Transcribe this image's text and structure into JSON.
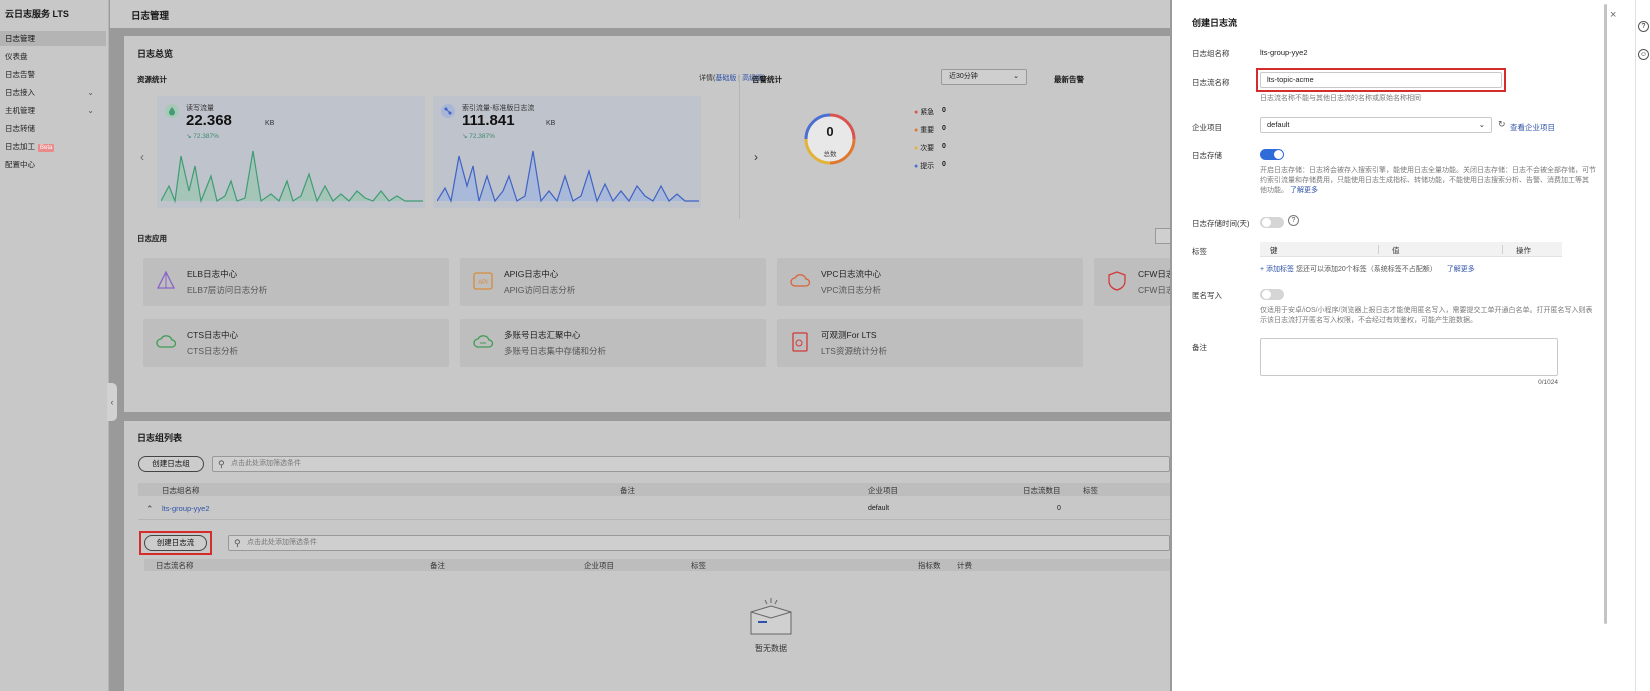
{
  "sidebar": {
    "title": "云日志服务 LTS",
    "items": [
      {
        "label": "日志管理",
        "active": true
      },
      {
        "label": "仪表盘"
      },
      {
        "label": "日志告警"
      },
      {
        "label": "日志接入",
        "chevron": "chevron-down-icon"
      },
      {
        "label": "主机管理",
        "chevron": "chevron-down-icon"
      },
      {
        "label": "日志转储"
      },
      {
        "label": "日志加工",
        "badge": "Beta"
      },
      {
        "label": "配置中心"
      }
    ]
  },
  "page": {
    "title": "日志管理"
  },
  "overview": {
    "title": "日志总览",
    "resource_title": "资源统计",
    "detail_prefix": "详情(",
    "detail_basic": "基础版",
    "detail_sep": " | ",
    "detail_advanced": "高级版",
    "detail_suffix": ")",
    "read_write": {
      "label": "读写流量",
      "value": "22.368",
      "unit": "KB",
      "change": "72.387%"
    },
    "index": {
      "label": "索引流量-标准版日志流",
      "value": "111.841",
      "unit": "KB",
      "change": "72.387%"
    },
    "alarm_title": "告警统计",
    "alarm_range": "近30分钟",
    "alarm_total_value": "0",
    "alarm_total_label": "总数",
    "alarm_levels": [
      {
        "label": "紧急",
        "value": "0",
        "color": "#d9534f"
      },
      {
        "label": "重要",
        "value": "0",
        "color": "#e0782f"
      },
      {
        "label": "次要",
        "value": "0",
        "color": "#e2b23a"
      },
      {
        "label": "提示",
        "value": "0",
        "color": "#4a6fd1"
      }
    ],
    "recent_title": "最新告警"
  },
  "apps": {
    "title": "日志应用",
    "items": [
      {
        "title": "ELB日志中心",
        "sub": "ELB7层访问日志分析",
        "icon": "elb-icon"
      },
      {
        "title": "APIG日志中心",
        "sub": "APIG访问日志分析",
        "icon": "apig-icon"
      },
      {
        "title": "VPC日志流中心",
        "sub": "VPC流日志分析",
        "icon": "vpc-cloud-icon"
      },
      {
        "title": "CFW日志",
        "sub": "CFW日志",
        "icon": "shield-icon"
      },
      {
        "title": "CTS日志中心",
        "sub": "CTS日志分析",
        "icon": "cts-cloud-icon"
      },
      {
        "title": "多账号日志汇聚中心",
        "sub": "多账号日志集中存储和分析",
        "icon": "multi-account-icon"
      },
      {
        "title": "可观测For LTS",
        "sub": "LTS资源统计分析",
        "icon": "observe-doc-icon"
      }
    ]
  },
  "groups": {
    "title": "日志组列表",
    "create_group": "创建日志组",
    "search_placeholder": "点击此处添加筛选条件",
    "columns": [
      "日志组名称",
      "备注",
      "企业项目",
      "日志流数目",
      "标签"
    ],
    "row": {
      "name": "lts-group-yye2",
      "enterprise": "default",
      "count": "0"
    },
    "create_stream": "创建日志流",
    "stream_search_placeholder": "点击此处添加筛选条件",
    "stream_columns": [
      "日志流名称",
      "备注",
      "企业项目",
      "标签",
      "指标数",
      "计费"
    ],
    "empty": "暂无数据"
  },
  "drawer": {
    "title": "创建日志流",
    "group_label": "日志组名称",
    "group_value": "lts-group-yye2",
    "stream_label": "日志流名称",
    "stream_value": "lts-topic-acme",
    "stream_hint": "日志流名称不能与其他日志流的名称或原始名称相同",
    "enterprise_label": "企业项目",
    "enterprise_value": "default",
    "enterprise_link": "查看企业项目",
    "storage_label": "日志存储",
    "storage_hint_1": "开启日志存储：日志将会被存入搜索引擎，能使用日志全量功能。关闭日志存储：日志不会被全部存储，可节",
    "storage_hint_2": "约索引流量和存储费用，只能使用日志生成指标、转储功能，不能使用日志搜索分析、告警、消费加工等其",
    "storage_hint_3": "他功能。",
    "storage_link": "了解更多",
    "retention_label": "日志存储时间(天)",
    "tags_label": "标签",
    "tag_columns": [
      "键",
      "值",
      "操作"
    ],
    "add_tag": "+ 添加标签",
    "add_tag_hint": "您还可以添加20个标签（系统标签不占配额）",
    "add_tag_link": "了解更多",
    "anon_label": "匿名写入",
    "anon_hint_1": "仅适用于安卓/iOS/小程序/浏览器上报日志才能使用匿名写入，需要提交工单开通白名单。打开匿名写入则表",
    "anon_hint_2": "示该日志流打开匿名写入权限，不会经过有效鉴权，可能产生脏数据。",
    "remark_label": "备注",
    "remark_count": "0/1024"
  },
  "right_rail": {
    "icons": [
      "help-icon",
      "smile-icon"
    ]
  }
}
